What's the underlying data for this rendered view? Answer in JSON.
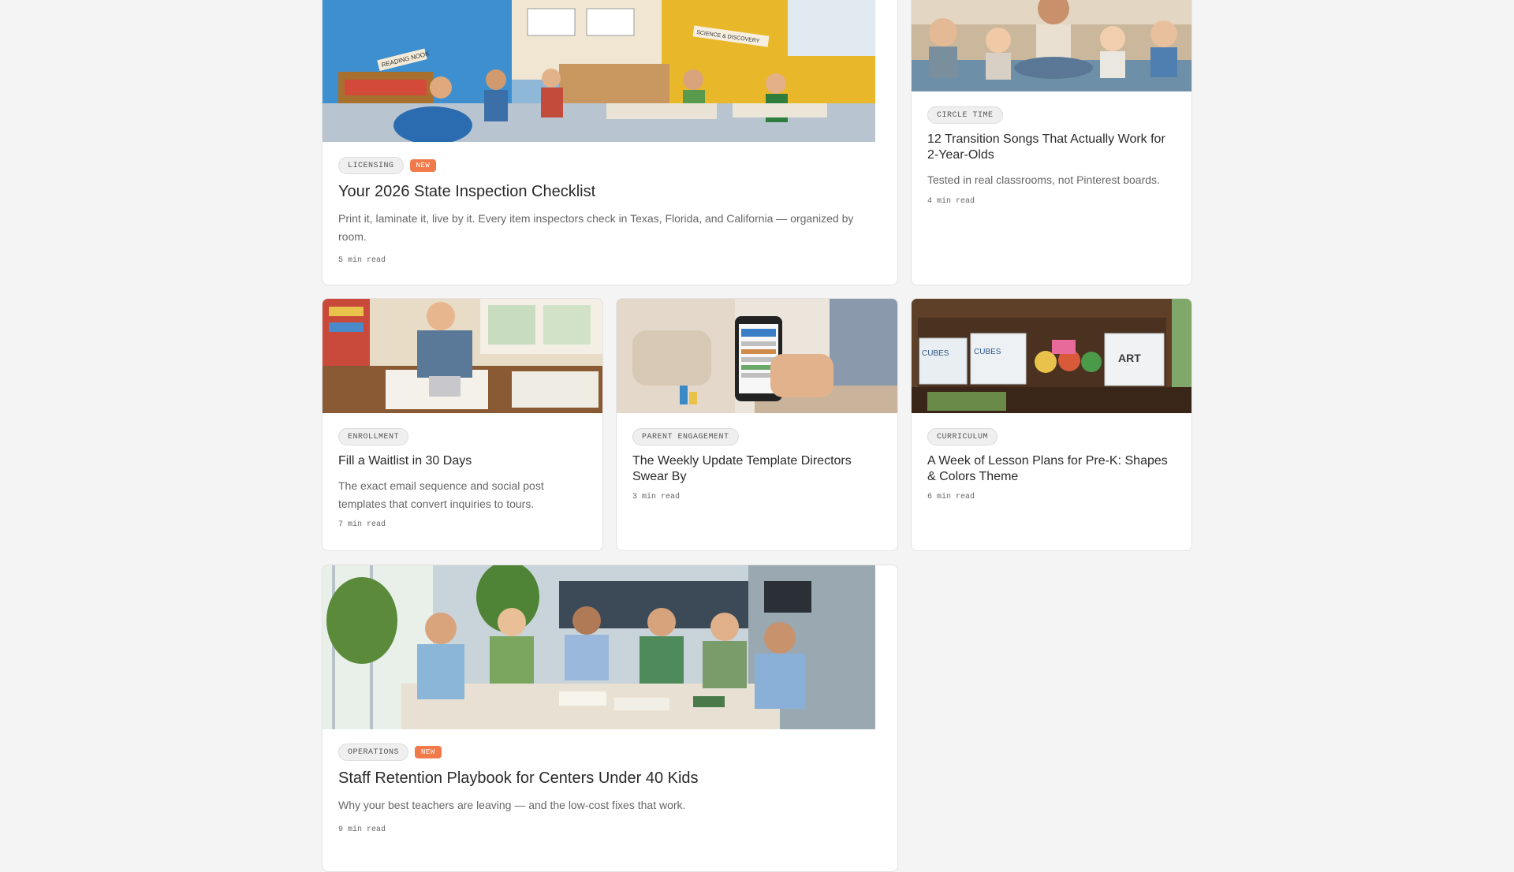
{
  "colors": {
    "page_background": "#f4f4f4",
    "card_background": "#ffffff",
    "new_badge": "#f07a4a",
    "tag_background": "#efefef"
  },
  "articles": [
    {
      "image_subject": "classroom-reading-nook",
      "tag": "LICENSING",
      "badge": "NEW",
      "title": "Your 2026 State Inspection Checklist",
      "excerpt": "Print it, laminate it, live by it. Every item inspectors check in Texas, Florida, and California — organized by room.",
      "read_time": "5 min read",
      "image_text": {
        "sign_1": "READING NOOK",
        "sign_2": "SCIENCE & DISCOVERY"
      }
    },
    {
      "image_subject": "toddlers-circle-time",
      "tag": "CIRCLE TIME",
      "title": "12 Transition Songs That Actually Work for 2-Year-Olds",
      "excerpt": "Tested in real classrooms, not Pinterest boards.",
      "read_time": "4 min read"
    },
    {
      "image_subject": "director-paperwork-desk",
      "tag": "ENROLLMENT",
      "title": "Fill a Waitlist in 30 Days",
      "excerpt": "The exact email sequence and social post templates that convert inquiries to tours.",
      "read_time": "7 min read"
    },
    {
      "image_subject": "phone-newsletter",
      "tag": "PARENT ENGAGEMENT",
      "title": "The Weekly Update Template Directors Swear By",
      "read_time": "3 min read"
    },
    {
      "image_subject": "supply-shelf-bins",
      "tag": "CURRICULUM",
      "title": "A Week of Lesson Plans for Pre-K: Shapes & Colors Theme",
      "read_time": "6 min read",
      "image_text": {
        "bin_1": "CUBES",
        "bin_2": "CUBES",
        "bin_3": "ART"
      }
    },
    {
      "image_subject": "staff-meeting-table",
      "tag": "OPERATIONS",
      "badge": "NEW",
      "title": "Staff Retention Playbook for Centers Under 40 Kids",
      "excerpt": "Why your best teachers are leaving — and the low-cost fixes that work.",
      "read_time": "9 min read"
    }
  ]
}
